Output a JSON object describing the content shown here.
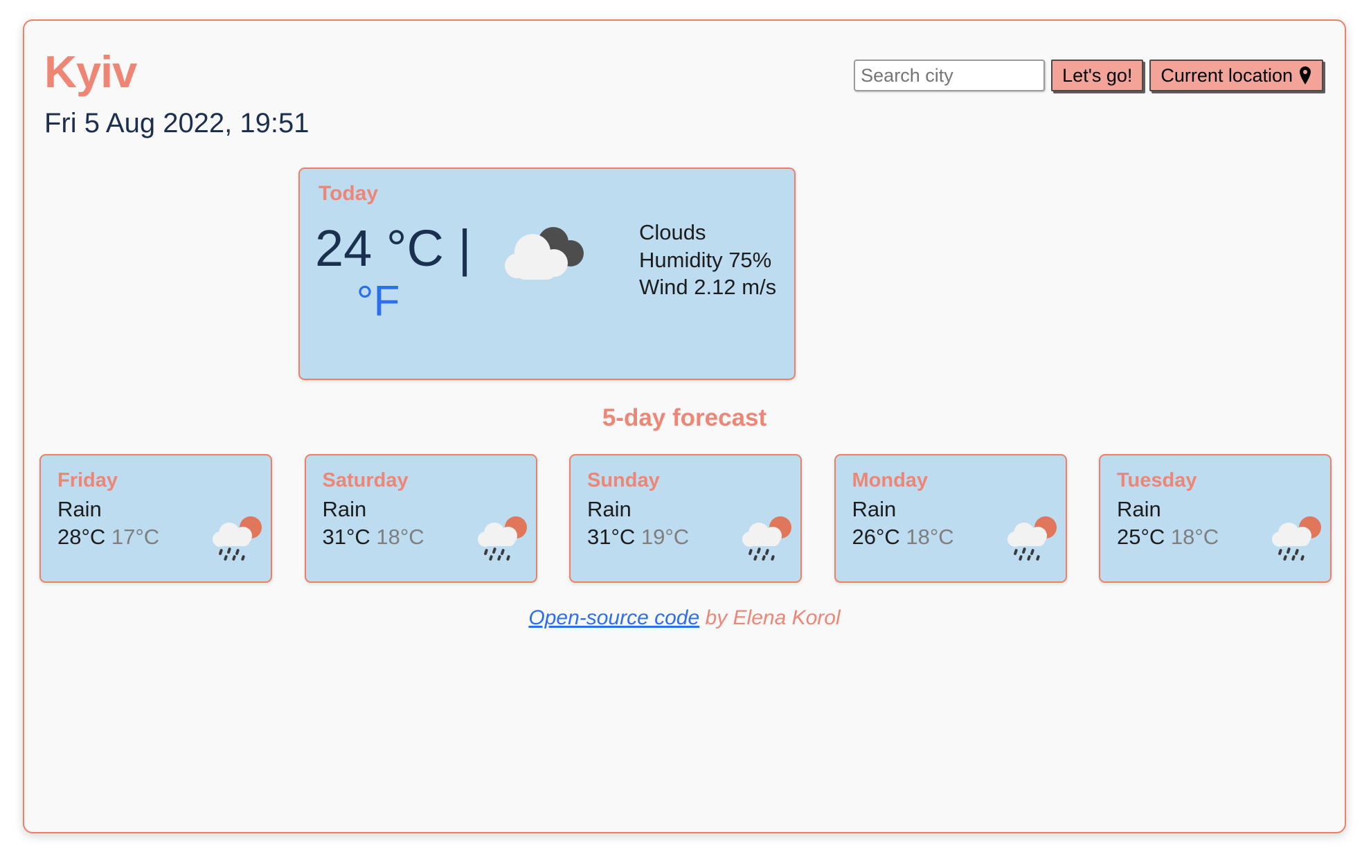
{
  "app": {
    "city": "Kyiv",
    "datetime": "Fri 5 Aug 2022, 19:51"
  },
  "search": {
    "placeholder": "Search city",
    "value": "",
    "submit_label": "Let's go!",
    "current_location_label": "Current location",
    "location_icon": "map-pin-icon"
  },
  "today": {
    "label": "Today",
    "temperature": "24 °C |",
    "unit_toggle": "°F",
    "icon": "clouds-icon",
    "condition": "Clouds",
    "humidity": "Humidity 75%",
    "wind": "Wind 2.12 m/s"
  },
  "forecast": {
    "title": "5-day forecast",
    "days": [
      {
        "day": "Friday",
        "condition": "Rain",
        "temp_max": "28°C",
        "temp_min": "17°C",
        "icon": "rain-sun-icon"
      },
      {
        "day": "Saturday",
        "condition": "Rain",
        "temp_max": "31°C",
        "temp_min": "18°C",
        "icon": "rain-sun-icon"
      },
      {
        "day": "Sunday",
        "condition": "Rain",
        "temp_max": "31°C",
        "temp_min": "19°C",
        "icon": "rain-sun-icon"
      },
      {
        "day": "Monday",
        "condition": "Rain",
        "temp_max": "26°C",
        "temp_min": "18°C",
        "icon": "rain-sun-icon"
      },
      {
        "day": "Tuesday",
        "condition": "Rain",
        "temp_max": "25°C",
        "temp_min": "18°C",
        "icon": "rain-sun-icon"
      }
    ]
  },
  "footer": {
    "link_text": "Open-source code",
    "author_text": " by Elena Korol"
  },
  "colors": {
    "accent": "#ee8675",
    "border": "#ef7e64",
    "card_bg": "#bddcf0",
    "text_dark": "#1b2f4e",
    "link": "#2b6ef0",
    "button_bg": "#f1a497",
    "muted": "#7e7e7e"
  }
}
